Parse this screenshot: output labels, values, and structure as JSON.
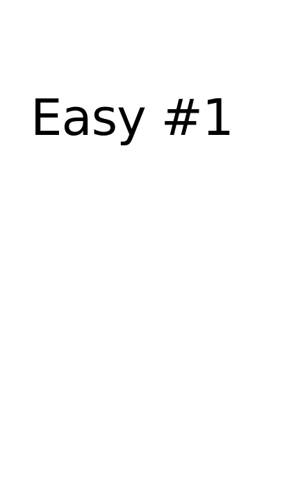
{
  "page": {
    "title": "Easy #1",
    "background_color": "#ffffff",
    "text_color": "#000000"
  }
}
